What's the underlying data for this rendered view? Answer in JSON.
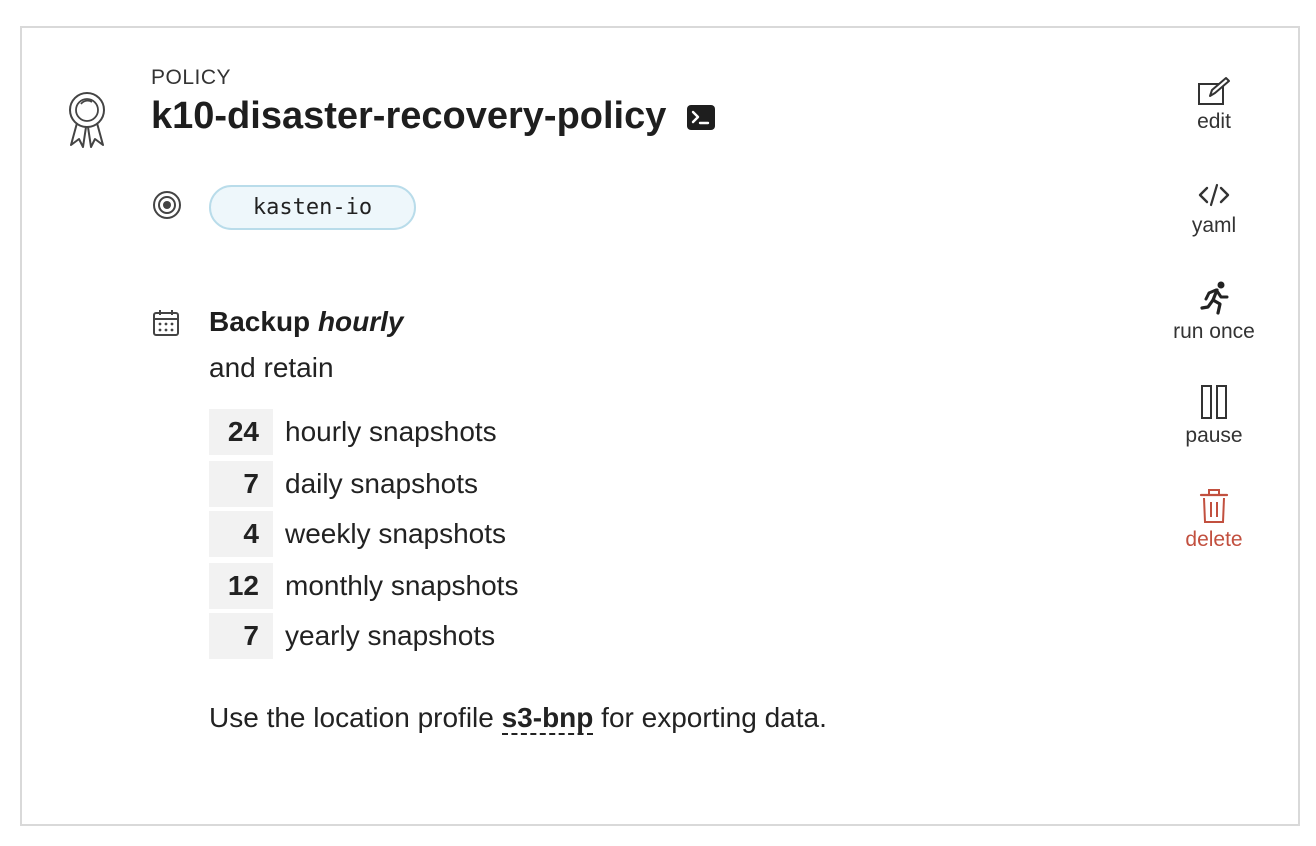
{
  "header": {
    "kind_label": "POLICY",
    "title": "k10-disaster-recovery-policy"
  },
  "namespace": {
    "name": "kasten-io"
  },
  "schedule": {
    "prefix": "Backup",
    "frequency": "hourly",
    "retain_label": "and retain"
  },
  "retention": [
    {
      "count": "24",
      "label": "hourly snapshots"
    },
    {
      "count": "7",
      "label": "daily snapshots"
    },
    {
      "count": "4",
      "label": "weekly snapshots"
    },
    {
      "count": "12",
      "label": "monthly snapshots"
    },
    {
      "count": "7",
      "label": "yearly snapshots"
    }
  ],
  "export": {
    "before": "Use the location profile",
    "profile": "s3-bnp",
    "after": "for exporting data."
  },
  "actions": {
    "edit": "edit",
    "yaml": "yaml",
    "run_once": "run once",
    "pause": "pause",
    "delete": "delete"
  },
  "colors": {
    "delete": "#c2503f",
    "pill_border": "#b9dcea",
    "pill_bg": "#eef7fb"
  }
}
